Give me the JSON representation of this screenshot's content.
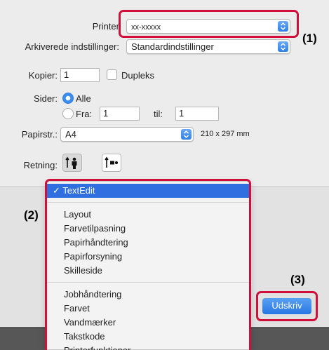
{
  "printer": {
    "label": "Printer",
    "value": "xx-xxxxx"
  },
  "presets": {
    "label": "Arkiverede indstillinger:",
    "value": "Standardindstillinger"
  },
  "copies": {
    "label": "Kopier:",
    "value": "1",
    "duplex_label": "Dupleks"
  },
  "pages": {
    "label": "Sider:",
    "all_label": "Alle",
    "from_label": "Fra:",
    "from_value": "1",
    "to_label": "til:",
    "to_value": "1"
  },
  "paper_size": {
    "label": "Papirstr.:",
    "value": "A4",
    "dimensions": "210 x 297 mm"
  },
  "orientation": {
    "label": "Retning:"
  },
  "menu": {
    "selected": "TextEdit",
    "group1": [
      "Layout",
      "Farvetilpasning",
      "Papirhåndtering",
      "Papirforsyning",
      "Skilleside"
    ],
    "group2": [
      "Jobhåndtering",
      "Farvet",
      "Vandmærker",
      "Takstkode",
      "Printerfunktioner"
    ]
  },
  "print_button": "Udskriv",
  "callouts": [
    "(1)",
    "(2)",
    "(3)"
  ],
  "colors": {
    "accent": "#2f6fe0",
    "callout": "#d0103a",
    "button": "#2777e3"
  }
}
